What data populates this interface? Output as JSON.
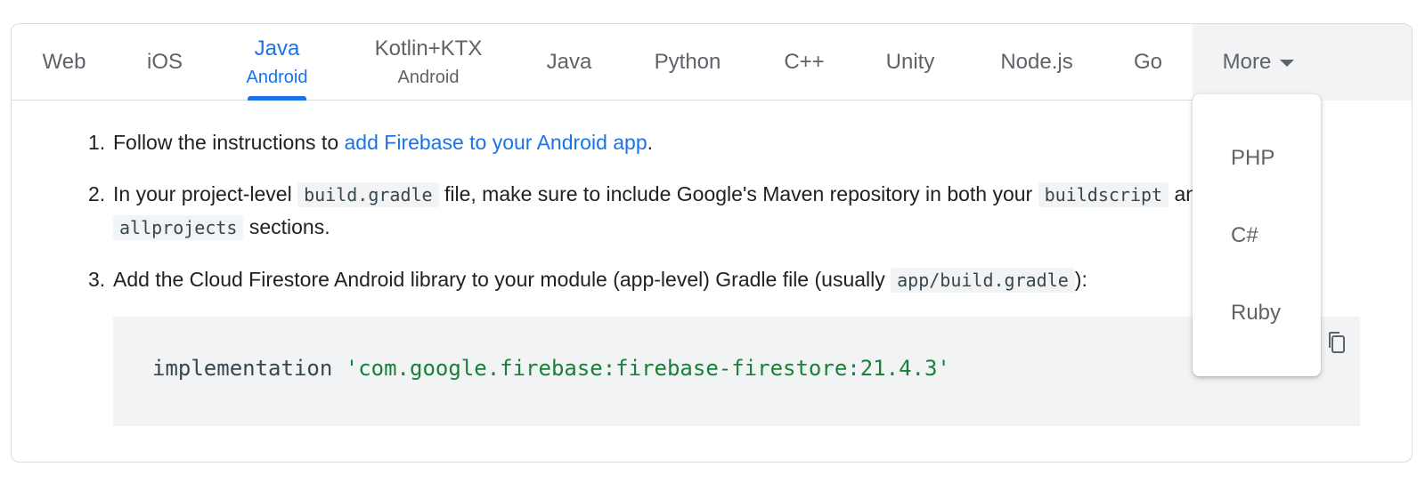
{
  "tabs": [
    {
      "label": "Web"
    },
    {
      "label": "iOS"
    },
    {
      "label": "Java",
      "sub": "Android"
    },
    {
      "label": "Kotlin+KTX",
      "sub": "Android"
    },
    {
      "label": "Java"
    },
    {
      "label": "Python"
    },
    {
      "label": "C++"
    },
    {
      "label": "Unity"
    },
    {
      "label": "Node.js"
    },
    {
      "label": "Go"
    },
    {
      "label": "More"
    }
  ],
  "steps": {
    "s1": {
      "number": "1.",
      "text_before": "Follow the instructions to ",
      "link": "add Firebase to your Android app",
      "text_after": "."
    },
    "s2": {
      "number": "2.",
      "text_before": "In your project-level ",
      "code1": "build.gradle",
      "text_mid": " file, make sure to include Google's Maven repository in both your ",
      "code2": "buildscript",
      "text_mid2": " and",
      "code3": "allprojects",
      "text_after": " sections."
    },
    "s3": {
      "number": "3.",
      "text_before": "Add the Cloud Firestore Android library to your module (app-level) Gradle file (usually ",
      "code1": "app/build.gradle",
      "text_after": "):"
    }
  },
  "code": {
    "keyword": "implementation ",
    "string": "'com.google.firebase:firebase-firestore:21.4.3'"
  },
  "dropdown": {
    "options": [
      "PHP",
      "C#",
      "Ruby"
    ]
  },
  "colors": {
    "accent": "#1a73e8",
    "code_string": "#188038"
  }
}
